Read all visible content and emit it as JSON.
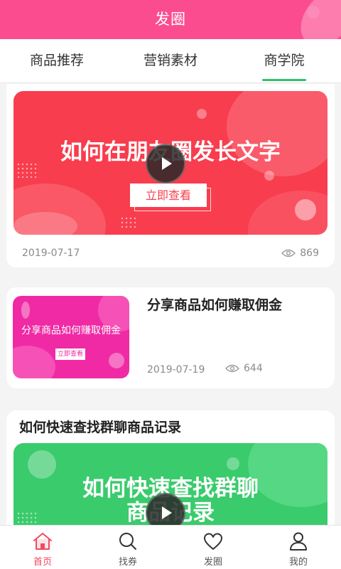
{
  "header": {
    "title": "发圈"
  },
  "tabs": [
    {
      "label": "商品推荐",
      "active": false
    },
    {
      "label": "营销素材",
      "active": false
    },
    {
      "label": "商学院",
      "active": true
    }
  ],
  "colors": {
    "brand": "#fb4c8f",
    "tab_indicator": "#2fc26b",
    "nav_active": "#f24a60"
  },
  "articles": [
    {
      "banner_title": "如何在朋友圈发长文字",
      "banner_button": "立即查看",
      "date": "2019-07-17",
      "views": "869",
      "banner_color": "#f83d4e"
    },
    {
      "title": "分享商品如何赚取佣金",
      "banner_title": "分享商品如何赚取佣金",
      "banner_button": "立即查看",
      "date": "2019-07-19",
      "views": "644",
      "banner_color": "#f02aa4"
    },
    {
      "title": "如何快速查找群聊商品记录",
      "banner_title_line1": "如何快速查找群聊",
      "banner_title_line2": "商品记录",
      "banner_color": "#3acb6c"
    }
  ],
  "bottom_nav": [
    {
      "label": "首页",
      "icon": "home-icon",
      "active": true
    },
    {
      "label": "找券",
      "icon": "search-icon",
      "active": false
    },
    {
      "label": "发圈",
      "icon": "heart-icon",
      "active": false
    },
    {
      "label": "我的",
      "icon": "user-icon",
      "active": false
    }
  ]
}
